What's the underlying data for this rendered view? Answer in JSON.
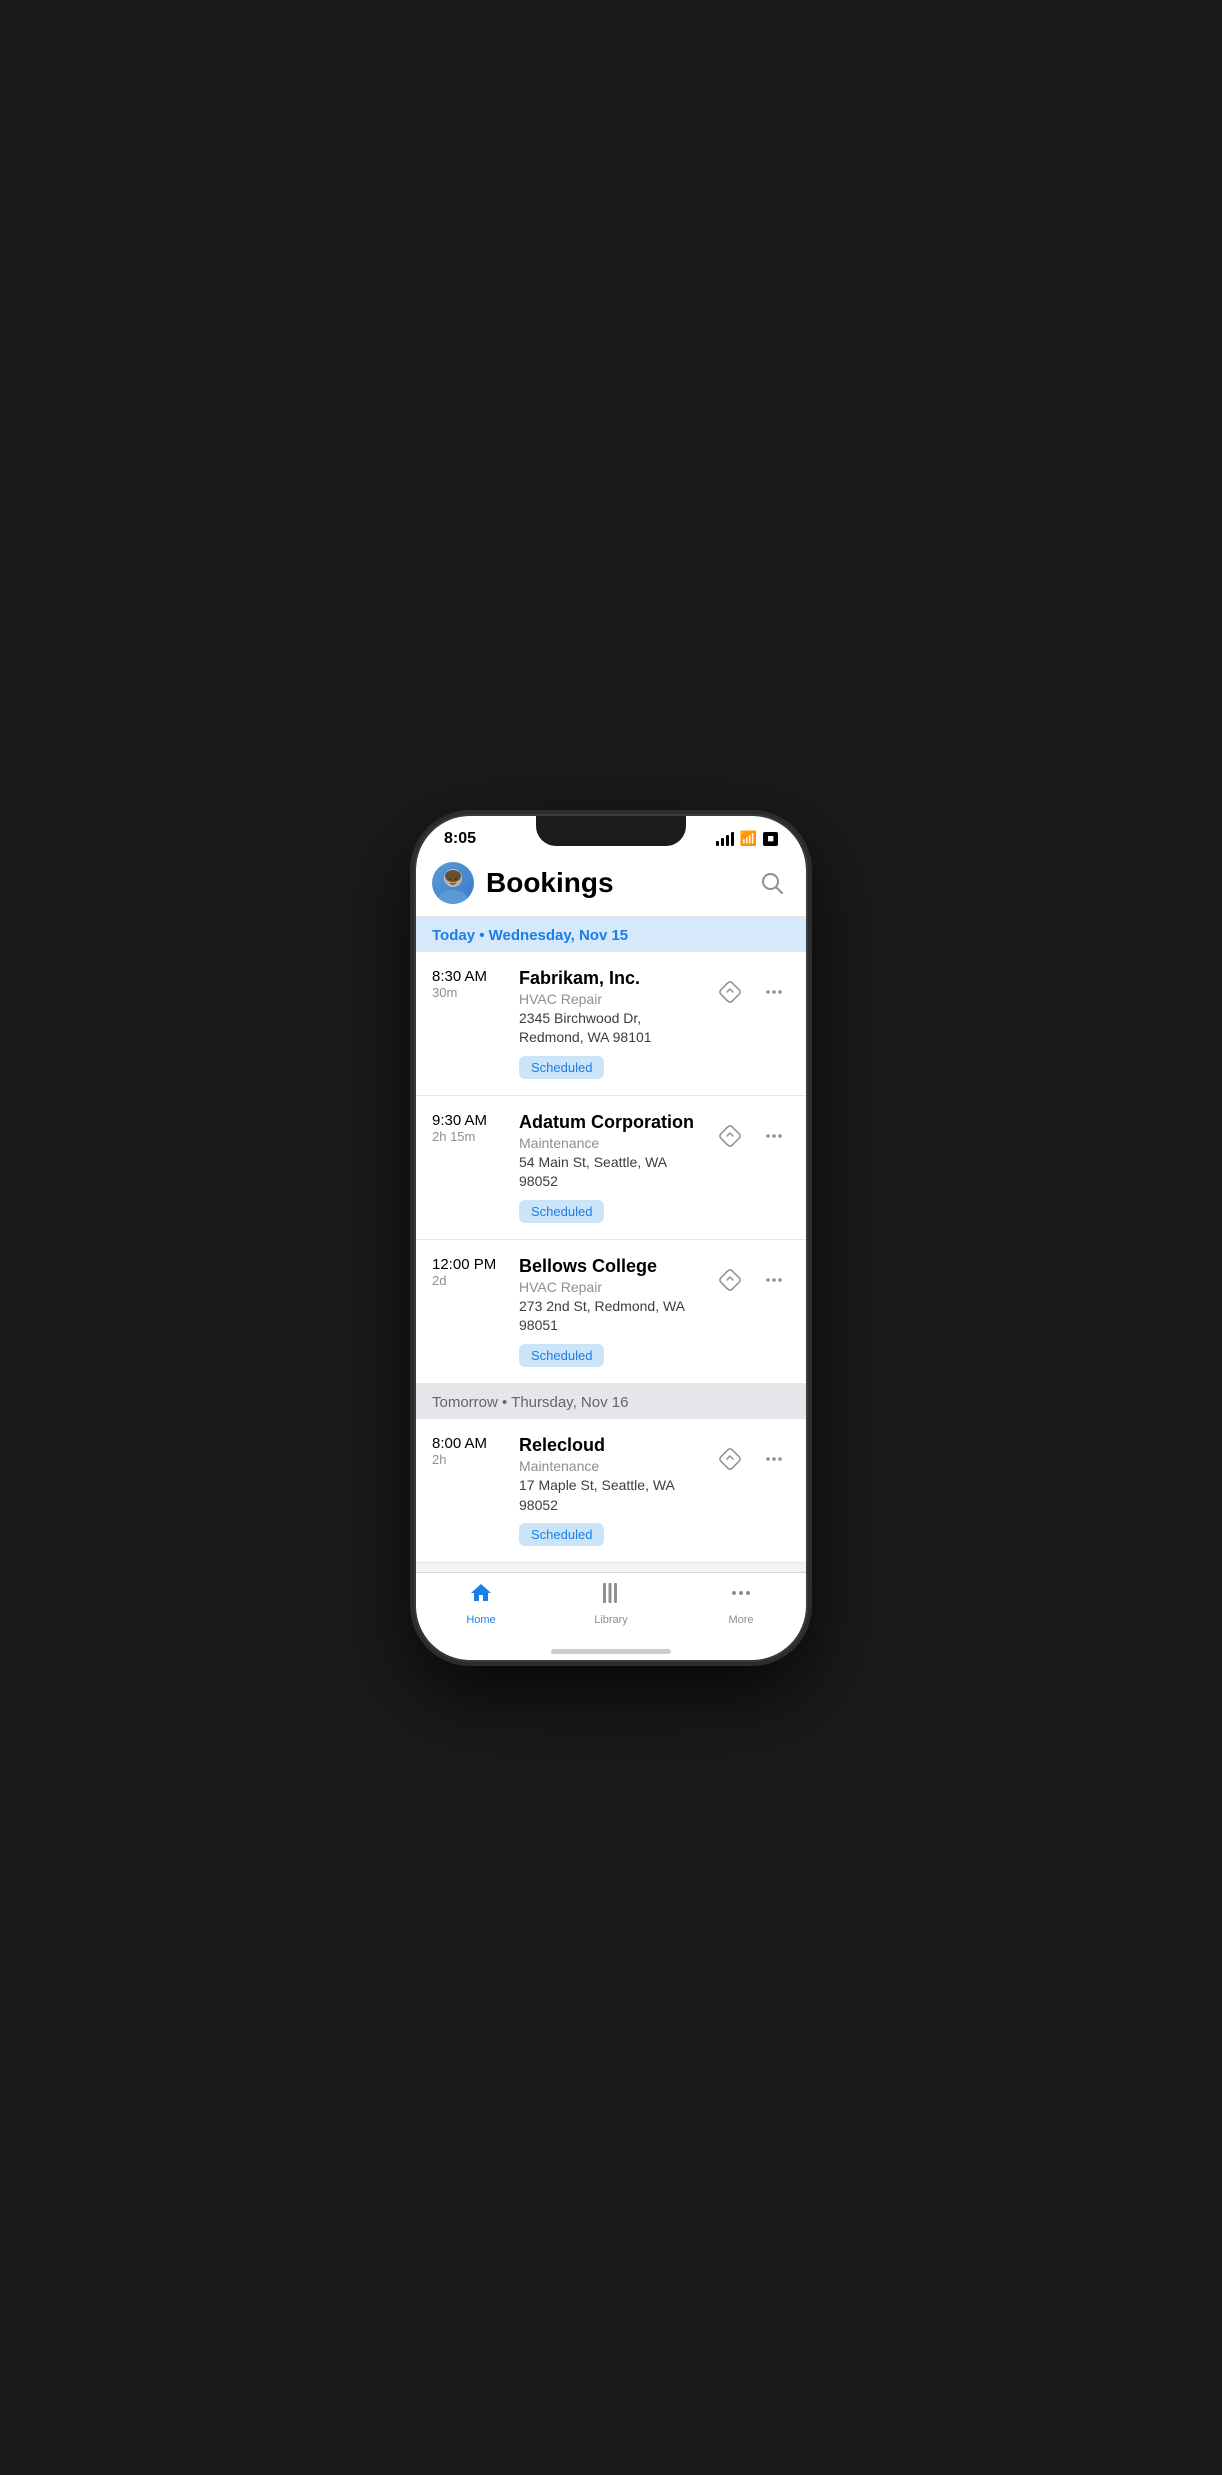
{
  "statusBar": {
    "time": "8:05"
  },
  "header": {
    "title": "Bookings",
    "searchLabel": "Search"
  },
  "sections": [
    {
      "id": "today",
      "label": "Today • Wednesday, Nov 15",
      "type": "today",
      "bookings": [
        {
          "id": "booking-1",
          "time": "8:30 AM",
          "duration": "30m",
          "name": "Fabrikam, Inc.",
          "serviceType": "HVAC Repair",
          "address": "2345 Birchwood Dr, Redmond, WA 98101",
          "status": "Scheduled"
        },
        {
          "id": "booking-2",
          "time": "9:30 AM",
          "duration": "2h 15m",
          "name": "Adatum Corporation",
          "serviceType": "Maintenance",
          "address": "54 Main St, Seattle, WA 98052",
          "status": "Scheduled"
        },
        {
          "id": "booking-3",
          "time": "12:00 PM",
          "duration": "2d",
          "name": "Bellows College",
          "serviceType": "HVAC Repair",
          "address": "273 2nd St, Redmond, WA 98051",
          "status": "Scheduled"
        }
      ]
    },
    {
      "id": "tomorrow",
      "label": "Tomorrow • Thursday, Nov 16",
      "type": "tomorrow",
      "bookings": [
        {
          "id": "booking-4",
          "time": "8:00 AM",
          "duration": "2h",
          "name": "Relecloud",
          "serviceType": "Maintenance",
          "address": "17 Maple St, Seattle, WA 98052",
          "status": "Scheduled"
        }
      ]
    }
  ],
  "tabBar": {
    "items": [
      {
        "id": "home",
        "label": "Home",
        "icon": "🏠",
        "active": true
      },
      {
        "id": "library",
        "label": "Library",
        "icon": "|||",
        "active": false
      },
      {
        "id": "more",
        "label": "More",
        "icon": "···",
        "active": false
      }
    ]
  }
}
